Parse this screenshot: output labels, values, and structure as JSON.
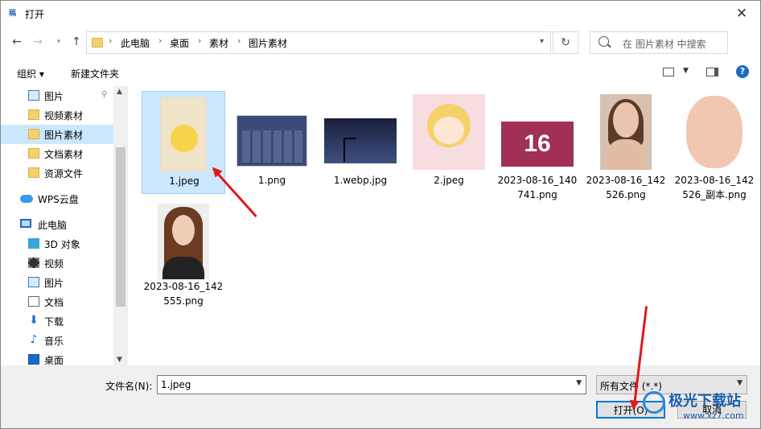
{
  "window": {
    "title": "打开",
    "app_icon_text": "稿"
  },
  "address": {
    "crumbs": [
      "此电脑",
      "桌面",
      "素材",
      "图片素材"
    ]
  },
  "search": {
    "placeholder": "在 图片素材 中搜索"
  },
  "toolbar": {
    "organize": "组织 ▾",
    "new_folder": "新建文件夹",
    "help": "?"
  },
  "sidebar": {
    "items": [
      {
        "label": "图片",
        "icon": "picture-icon"
      },
      {
        "label": "视频素材",
        "icon": "folder-icon"
      },
      {
        "label": "图片素材",
        "icon": "folder-icon",
        "selected": true
      },
      {
        "label": "文档素材",
        "icon": "folder-icon"
      },
      {
        "label": "资源文件",
        "icon": "folder-icon"
      },
      {
        "label": "WPS云盘",
        "icon": "cloud-icon"
      },
      {
        "label": "此电脑",
        "icon": "pc-icon"
      },
      {
        "label": "3D 对象",
        "icon": "cube-icon"
      },
      {
        "label": "视频",
        "icon": "video-icon"
      },
      {
        "label": "图片",
        "icon": "picture-icon"
      },
      {
        "label": "文档",
        "icon": "document-icon"
      },
      {
        "label": "下载",
        "icon": "download-icon"
      },
      {
        "label": "音乐",
        "icon": "music-icon"
      },
      {
        "label": "桌面",
        "icon": "desktop-icon"
      }
    ]
  },
  "files": [
    {
      "name": "1.jpeg",
      "selected": true
    },
    {
      "name": "1.png"
    },
    {
      "name": "1.webp.jpg"
    },
    {
      "name": "2.jpeg"
    },
    {
      "name": "2023-08-16_140741.png",
      "line1": "2023-08-16_140",
      "line2": "741.png",
      "thumb_text": "16"
    },
    {
      "name": "2023-08-16_142526.png",
      "line1": "2023-08-16_142",
      "line2": "526.png"
    },
    {
      "name": "2023-08-16_142526_副本.png",
      "line1": "2023-08-16_142",
      "line2": "526_副本.png"
    },
    {
      "name": "2023-08-16_142555.png",
      "line1": "2023-08-16_142",
      "line2": "555.png"
    }
  ],
  "bottom": {
    "filename_label": "文件名(N):",
    "filename_value": "1.jpeg",
    "filetype_value": "所有文件 (*.*)",
    "open_label": "打开(O)",
    "cancel_label": "取消"
  },
  "watermark": {
    "text": "极光下载站",
    "url": "www.xz7.com"
  },
  "colors": {
    "selection": "#cce8ff",
    "accent": "#0078d7",
    "arrow": "#e0191a"
  }
}
